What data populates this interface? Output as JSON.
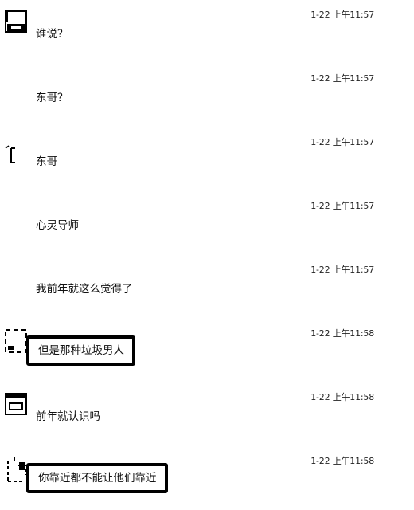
{
  "messages": [
    {
      "time": "1-22 上午11:57",
      "text": "谁说？"
    },
    {
      "time": "1-22 上午11:57",
      "text": "东哥？"
    },
    {
      "time": "1-22 上午11:57",
      "text": "东哥"
    },
    {
      "time": "1-22 上午11:57",
      "text": "心灵导师"
    },
    {
      "time": "1-22 上午11:57",
      "text": "我前年就这么觉得了"
    },
    {
      "time": "1-22 上午11:58",
      "text": "但是那种垃圾男人"
    },
    {
      "time": "1-22 上午11:58",
      "text": "前年就认识吗"
    },
    {
      "time": "1-22 上午11:58",
      "text": "你靠近都不能让他们靠近"
    }
  ]
}
